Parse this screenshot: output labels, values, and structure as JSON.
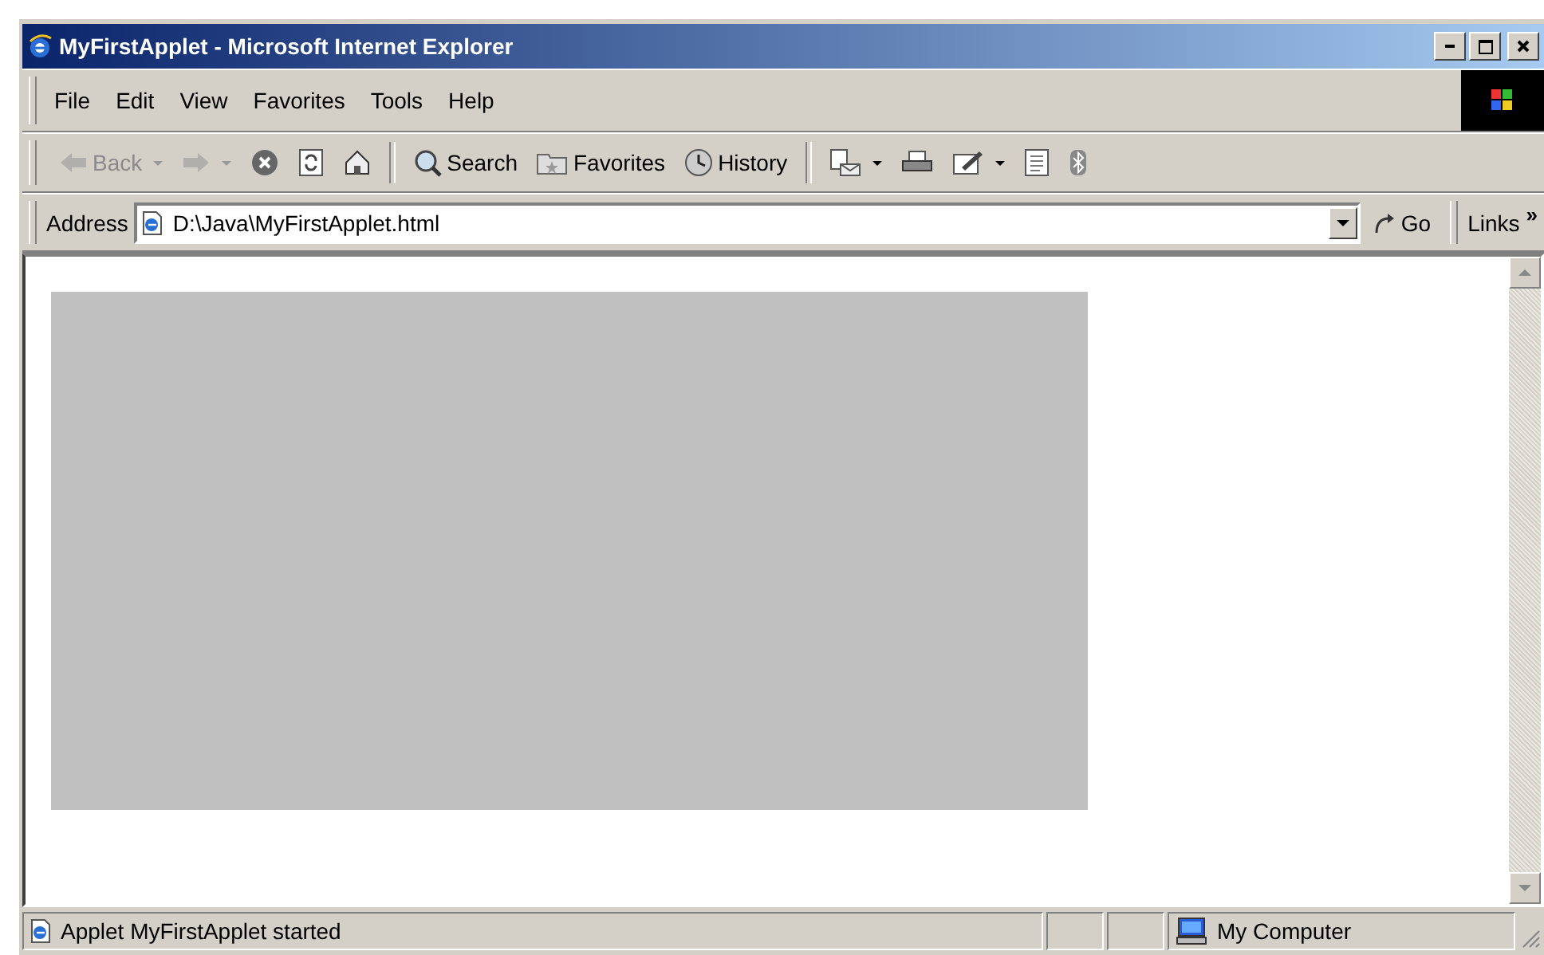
{
  "window": {
    "title": "MyFirstApplet - Microsoft Internet Explorer"
  },
  "menu": [
    {
      "label": "File"
    },
    {
      "label": "Edit"
    },
    {
      "label": "View"
    },
    {
      "label": "Favorites"
    },
    {
      "label": "Tools"
    },
    {
      "label": "Help"
    }
  ],
  "toolbar": [
    {
      "kind": "back",
      "label": "Back",
      "dropdown": true,
      "disabled": true
    },
    {
      "kind": "forward",
      "dropdown": true,
      "disabled": true
    },
    {
      "kind": "stop",
      "dropdown": false,
      "disabled": false
    },
    {
      "kind": "refresh",
      "dropdown": false,
      "disabled": false
    },
    {
      "kind": "home",
      "dropdown": false,
      "disabled": false
    },
    {
      "kind": "separator"
    },
    {
      "kind": "search",
      "label": "Search",
      "dropdown": false,
      "disabled": false
    },
    {
      "kind": "favorites",
      "label": "Favorites",
      "dropdown": false,
      "disabled": false
    },
    {
      "kind": "history",
      "label": "History",
      "dropdown": false,
      "disabled": false
    },
    {
      "kind": "separator"
    },
    {
      "kind": "mail",
      "dropdown": true,
      "disabled": false
    },
    {
      "kind": "print",
      "dropdown": false,
      "disabled": false
    },
    {
      "kind": "edit",
      "dropdown": true,
      "disabled": false
    },
    {
      "kind": "discuss",
      "dropdown": false,
      "disabled": false
    },
    {
      "kind": "messenger",
      "dropdown": false,
      "disabled": false
    }
  ],
  "address": {
    "label": "Address",
    "value": "D:\\Java\\MyFirstApplet.html",
    "go": "Go",
    "links": "Links",
    "more": "»"
  },
  "status_bar": {
    "message": "Applet MyFirstApplet started",
    "zone": "My Computer"
  }
}
